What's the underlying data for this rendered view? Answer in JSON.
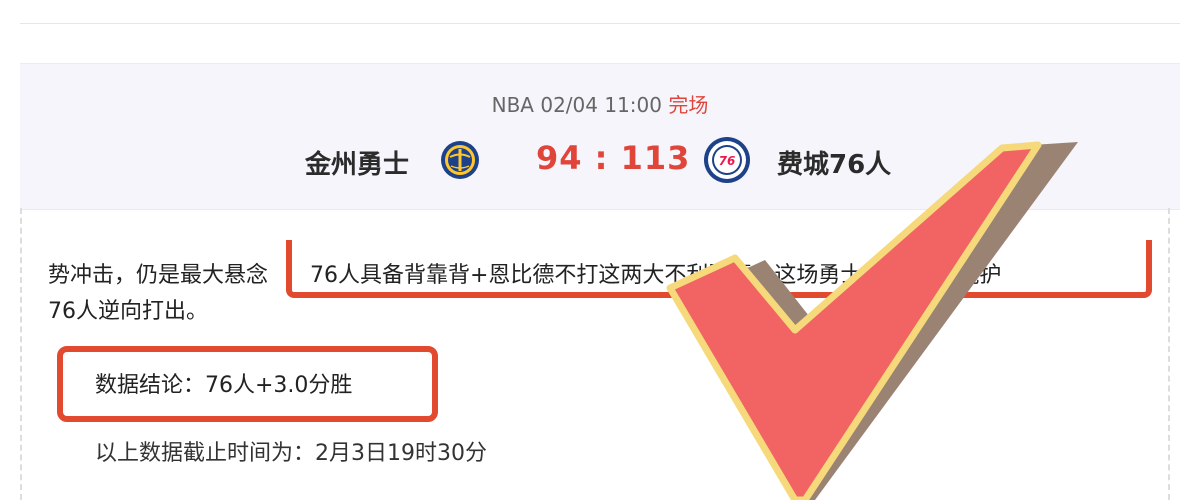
{
  "match": {
    "league": "NBA",
    "datetime": "02/04 11:00",
    "status": "完场",
    "home_team": "金州勇士",
    "away_team": "费城76人",
    "score": "94 : 113"
  },
  "article": {
    "line1_prefix": "势冲击，仍是最大悬念",
    "line2": "76人逆向打出。",
    "highlight": "76人具备背靠背+恩比德不打这两大不利因素，这场勇士                  ，这更能掩护",
    "conclusion": "数据结论：76人+3.0分胜",
    "cutoff": "以上数据截止时间为：2月3日19时30分"
  },
  "icons": {
    "home_logo": "warriors-logo-icon",
    "away_logo": "76ers-logo-icon",
    "overlay": "checkmark-icon"
  },
  "colors": {
    "accent_red": "#e0453a",
    "box_red": "#e24a2f",
    "check_fill": "#f26363",
    "check_outline": "#f5d97a",
    "check_shadow": "#9b8373",
    "card_bg": "#f5f5fb"
  }
}
